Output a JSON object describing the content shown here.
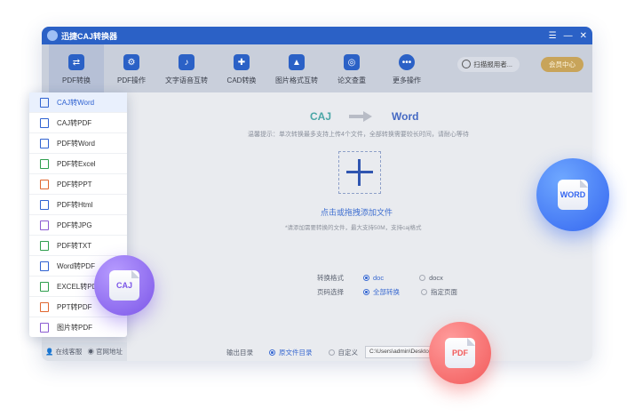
{
  "app": {
    "title": "迅捷CAJ转换器",
    "window_controls": [
      "☰",
      "—",
      "✕"
    ]
  },
  "toolbar": {
    "items": [
      {
        "label": "PDF转换",
        "icon": "convert-icon",
        "color": "#2b61c6"
      },
      {
        "label": "PDF操作",
        "icon": "gear-icon",
        "color": "#2b61c6"
      },
      {
        "label": "文字语音互转",
        "icon": "voice-icon",
        "color": "#2b61c6"
      },
      {
        "label": "CAD转换",
        "icon": "cad-icon",
        "color": "#2b61c6"
      },
      {
        "label": "图片格式互转",
        "icon": "image-icon",
        "color": "#2b61c6"
      },
      {
        "label": "论文查重",
        "icon": "search-doc-icon",
        "color": "#2b61c6"
      },
      {
        "label": "更多操作",
        "icon": "more-icon",
        "color": "#2b61c6"
      }
    ],
    "user_label": "扫描报用者...",
    "member_label": "会员中心"
  },
  "sidebar_bottom": {
    "service": "在线客服",
    "website": "官网地址"
  },
  "converter": {
    "from": "CAJ",
    "to": "Word"
  },
  "tip": "温馨提示：单次转换最多支持上传4个文件，全部转换需要较长时间，请耐心等待",
  "drop": {
    "title": "点击或拖拽添加文件",
    "subtitle": "*请添加需要转换的文件，最大支持50M，支持caj格式"
  },
  "options": {
    "format_label": "转换格式",
    "format_opts": [
      "doc",
      "docx"
    ],
    "page_label": "页码选择",
    "page_opts": [
      "全部转换",
      "指定页面"
    ]
  },
  "output": {
    "label": "输出目录",
    "opt1": "原文件目录",
    "opt2": "自定义",
    "path": "C:\\Users\\admin\\Desktop\\"
  },
  "menu": {
    "items": [
      "CAJ转Word",
      "CAJ转PDF",
      "PDF转Word",
      "PDF转Excel",
      "PDF转PPT",
      "PDF转Html",
      "PDF转JPG",
      "PDF转TXT",
      "Word转PDF",
      "EXCEL转PDF",
      "PPT转PDF",
      "图片转PDF"
    ],
    "icon_colors": [
      "#2f62d1",
      "#2f62d1",
      "#2f62d1",
      "#2e9e4d",
      "#e0662f",
      "#2f62d1",
      "#8b5bd1",
      "#2e9e4d",
      "#2f62d1",
      "#2e9e4d",
      "#e0662f",
      "#8b5bd1"
    ]
  },
  "badges": {
    "word": "WORD",
    "caj": "CAJ",
    "pdf": "PDF"
  }
}
